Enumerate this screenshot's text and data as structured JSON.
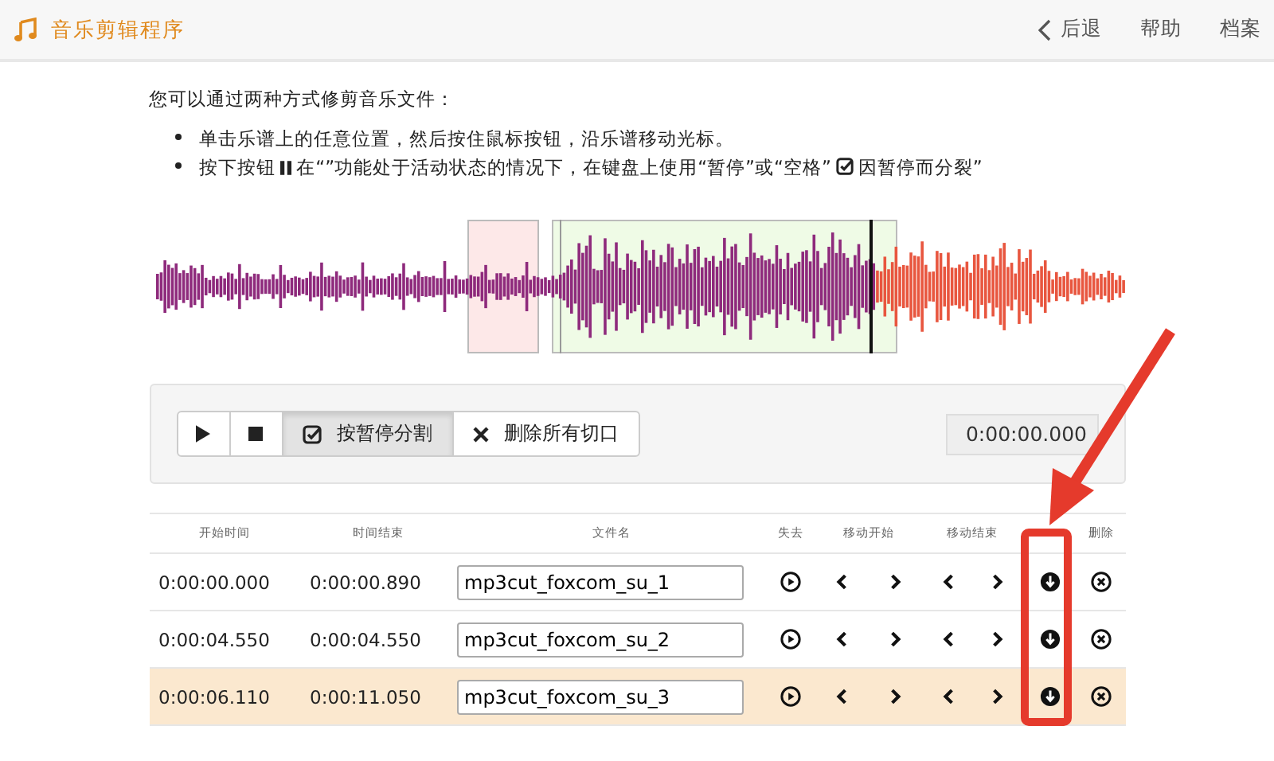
{
  "header": {
    "title": "音乐剪辑程序",
    "nav": [
      {
        "label": "后退",
        "kind": "back"
      },
      {
        "label": "帮助",
        "kind": "link"
      },
      {
        "label": "档案",
        "kind": "link"
      }
    ]
  },
  "intro": "您可以通过两种方式修剪音乐文件：",
  "bullets": [
    {
      "kind": "plain",
      "parts": [
        "单击乐谱上的任意位置，然后按住鼠标按钮，沿乐谱移动光标。"
      ]
    },
    {
      "kind": "icons",
      "parts": [
        "按下按钮",
        "在“”功能处于活动状态的情况下，在键盘上使用“暂停”或“空格”",
        "因暂停而分裂”"
      ]
    }
  ],
  "controls": {
    "split_button": {
      "label": "按暂停分割",
      "pressed": true
    },
    "delete_all_button": {
      "label": "删除所有切口"
    },
    "time": "0:00:00.000"
  },
  "table": {
    "columns": [
      "开始时间",
      "时间结束",
      "文件名",
      "失去",
      "移动开始",
      "移动结束",
      "删除"
    ],
    "rows": [
      {
        "start": "0:00:00.000",
        "end": "0:00:00.890",
        "filename": "mp3cut_foxcom_su_1",
        "selected": false
      },
      {
        "start": "0:00:04.550",
        "end": "0:00:04.550",
        "filename": "mp3cut_foxcom_su_2",
        "selected": false
      },
      {
        "start": "0:00:06.110",
        "end": "0:00:11.050",
        "filename": "mp3cut_foxcom_su_3",
        "selected": true
      }
    ]
  }
}
